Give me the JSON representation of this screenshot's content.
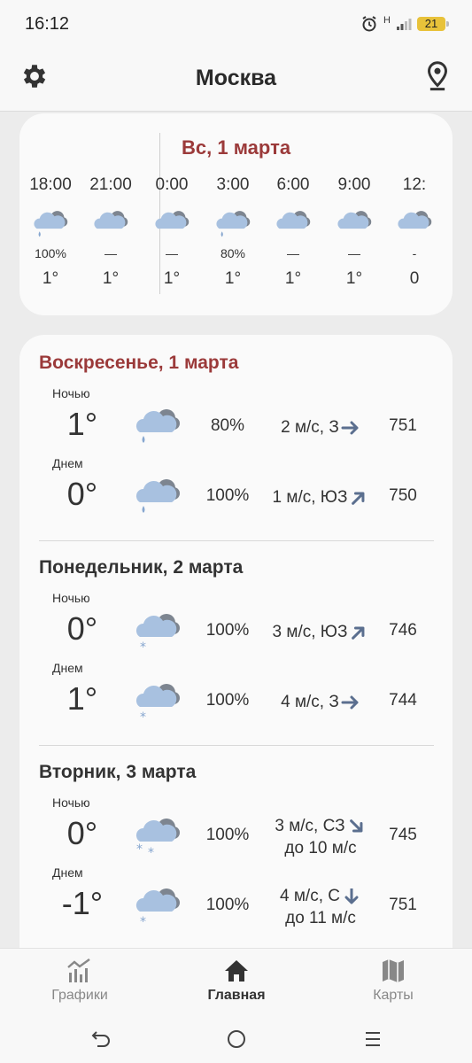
{
  "status": {
    "time": "16:12",
    "battery": "21",
    "network": "H"
  },
  "app": {
    "title": "Москва"
  },
  "hourly": {
    "date_label": "Вс, 1 марта",
    "hours": [
      {
        "time": "18:00",
        "prob": "100%",
        "temp": "1°",
        "icon": "cloud-rain-icon"
      },
      {
        "time": "21:00",
        "prob": "—",
        "temp": "1°",
        "icon": "cloud-icon"
      },
      {
        "time": "0:00",
        "prob": "—",
        "temp": "1°",
        "icon": "cloud-icon"
      },
      {
        "time": "3:00",
        "prob": "80%",
        "temp": "1°",
        "icon": "cloud-rain-icon"
      },
      {
        "time": "6:00",
        "prob": "—",
        "temp": "1°",
        "icon": "cloud-icon"
      },
      {
        "time": "9:00",
        "prob": "—",
        "temp": "1°",
        "icon": "cloud-icon"
      },
      {
        "time": "12:",
        "prob": "-",
        "temp": "0",
        "icon": "cloud-icon"
      }
    ]
  },
  "days": [
    {
      "title": "Воскресенье, 1 марта",
      "rows": [
        {
          "label": "Ночью",
          "temp": "1°",
          "prob": "80%",
          "wind": "2 м/с, З",
          "wind_extra": "",
          "pressure": "751",
          "icon": "cloud-rain-icon",
          "wind_dir": "east"
        },
        {
          "label": "Днем",
          "temp": "0°",
          "prob": "100%",
          "wind": "1 м/с, ЮЗ",
          "wind_extra": "",
          "pressure": "750",
          "icon": "cloud-rain-icon",
          "wind_dir": "northeast"
        }
      ]
    },
    {
      "title": "Понедельник, 2 марта",
      "rows": [
        {
          "label": "Ночью",
          "temp": "0°",
          "prob": "100%",
          "wind": "3 м/с, ЮЗ",
          "wind_extra": "",
          "pressure": "746",
          "icon": "cloud-snow-icon",
          "wind_dir": "northeast"
        },
        {
          "label": "Днем",
          "temp": "1°",
          "prob": "100%",
          "wind": "4 м/с, З",
          "wind_extra": "",
          "pressure": "744",
          "icon": "cloud-snow-icon",
          "wind_dir": "east"
        }
      ]
    },
    {
      "title": "Вторник, 3 марта",
      "rows": [
        {
          "label": "Ночью",
          "temp": "0°",
          "prob": "100%",
          "wind": "3 м/с, СЗ",
          "wind_extra": "до 10 м/с",
          "pressure": "745",
          "icon": "cloud-heavy-snow-icon",
          "wind_dir": "southeast"
        },
        {
          "label": "Днем",
          "temp": "-1°",
          "prob": "100%",
          "wind": "4 м/с, С",
          "wind_extra": "до 11 м/с",
          "pressure": "751",
          "icon": "cloud-snow-icon",
          "wind_dir": "south"
        }
      ]
    }
  ],
  "nav": {
    "charts": "Графики",
    "home": "Главная",
    "maps": "Карты"
  },
  "colors": {
    "accent": "#9b3a3a",
    "cloud": "#a8c1e0",
    "cloud_dark": "#7d8590",
    "arrow": "#5b6f8f"
  }
}
